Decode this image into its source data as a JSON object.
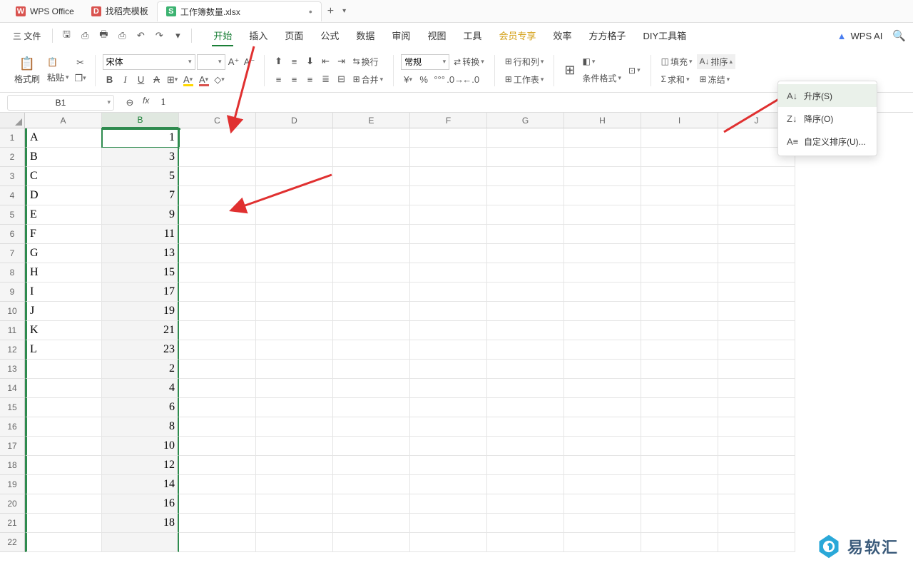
{
  "tabs": {
    "wps": "WPS Office",
    "template": "找稻壳模板",
    "active": "工作簿数量.xlsx"
  },
  "toolbar": {
    "file": "三 文件"
  },
  "ribbon_tabs": [
    "开始",
    "插入",
    "页面",
    "公式",
    "数据",
    "审阅",
    "视图",
    "工具",
    "会员专享",
    "效率",
    "方方格子",
    "DIY工具箱"
  ],
  "wpsai": "WPS AI",
  "ribbon": {
    "format_painter": "格式刷",
    "paste": "粘贴",
    "font": "宋体",
    "size": "",
    "wrap": "换行",
    "num_format": "常规",
    "convert": "转换",
    "row_col": "行和列",
    "worksheet": "工作表",
    "merge": "合并",
    "cond_format": "条件格式",
    "fill": "填充",
    "sort": "排序",
    "sum": "求和",
    "freeze": "冻结"
  },
  "namebox": {
    "cell": "B1",
    "formula": "1"
  },
  "columns": [
    "A",
    "B",
    "C",
    "D",
    "E",
    "F",
    "G",
    "H",
    "I",
    "J"
  ],
  "rows": [
    "1",
    "2",
    "3",
    "4",
    "5",
    "6",
    "7",
    "8",
    "9",
    "10",
    "11",
    "12",
    "13",
    "14",
    "15",
    "16",
    "17",
    "18",
    "19",
    "20",
    "21",
    "22"
  ],
  "data": {
    "A": [
      "A",
      "B",
      "C",
      "D",
      "E",
      "F",
      "G",
      "H",
      "I",
      "J",
      "K",
      "L",
      "",
      "",
      "",
      "",
      "",
      "",
      "",
      "",
      "",
      ""
    ],
    "B": [
      "1",
      "3",
      "5",
      "7",
      "9",
      "11",
      "13",
      "15",
      "17",
      "19",
      "21",
      "23",
      "2",
      "4",
      "6",
      "8",
      "10",
      "12",
      "14",
      "16",
      "18",
      ""
    ]
  },
  "sort_menu": {
    "asc": "升序(S)",
    "desc": "降序(O)",
    "custom": "自定义排序(U)..."
  },
  "logo": "易软汇"
}
